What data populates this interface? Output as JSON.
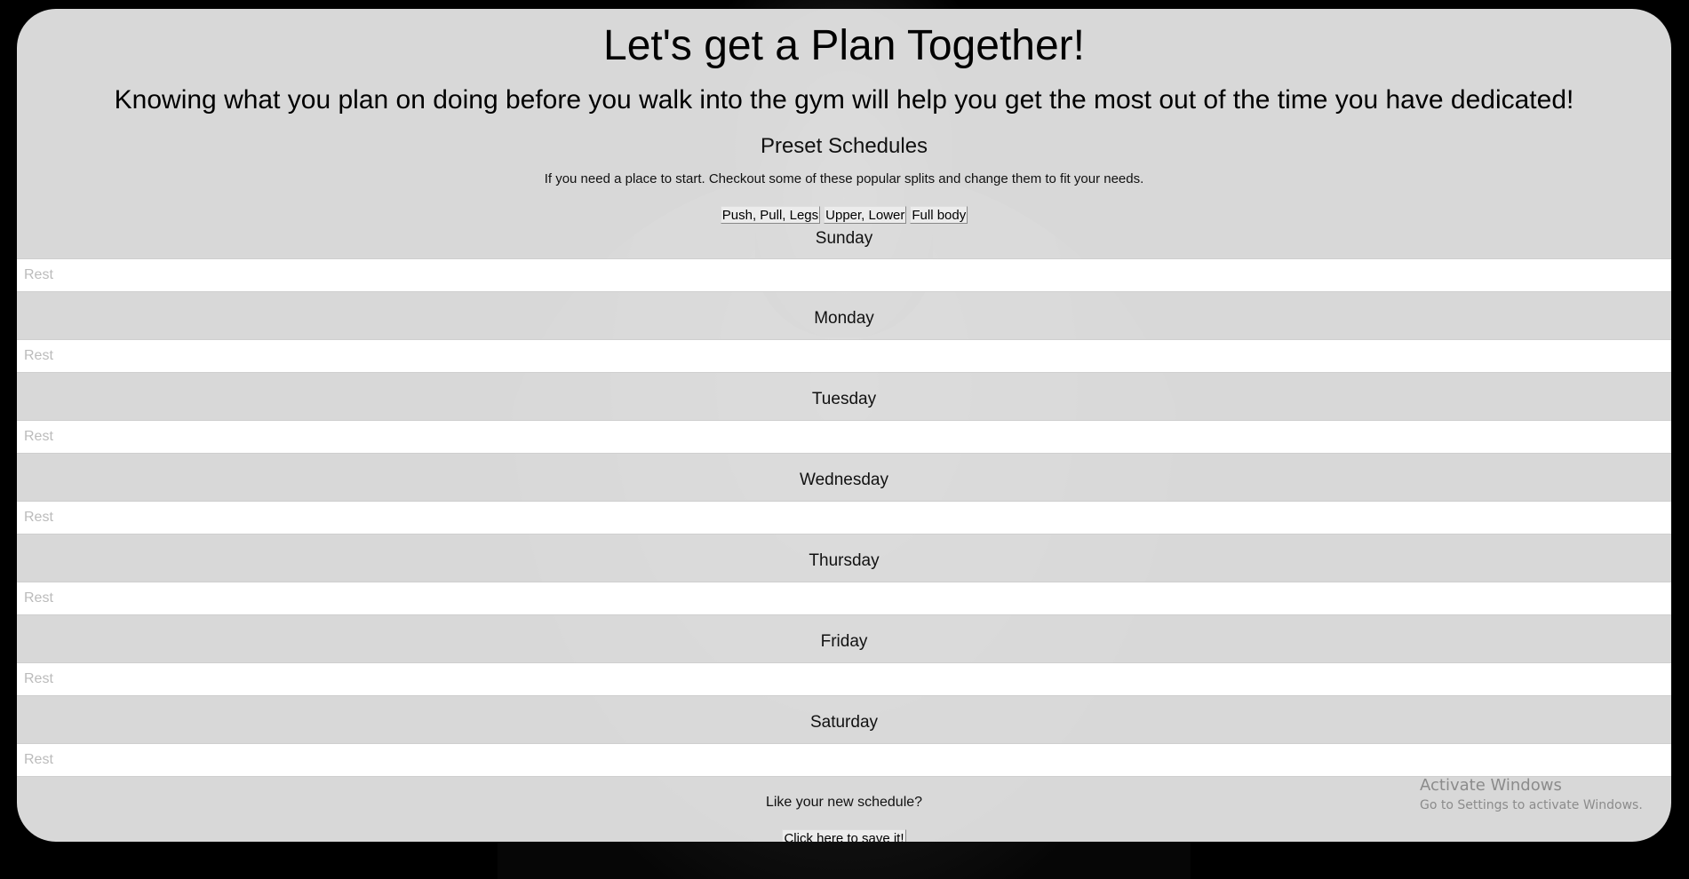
{
  "header": {
    "title": "Let's get a Plan Together!",
    "subtitle": "Knowing what you plan on doing before you walk into the gym will help you get the most out of the time you have dedicated!"
  },
  "presets": {
    "heading": "Preset Schedules",
    "description": "If you need a place to start. Checkout some of these popular splits and change them to fit your needs.",
    "buttons": [
      "Push, Pull, Legs",
      "Upper, Lower",
      "Full body"
    ]
  },
  "days": [
    {
      "label": "Sunday",
      "placeholder": "Rest",
      "value": ""
    },
    {
      "label": "Monday",
      "placeholder": "Rest",
      "value": ""
    },
    {
      "label": "Tuesday",
      "placeholder": "Rest",
      "value": ""
    },
    {
      "label": "Wednesday",
      "placeholder": "Rest",
      "value": ""
    },
    {
      "label": "Thursday",
      "placeholder": "Rest",
      "value": ""
    },
    {
      "label": "Friday",
      "placeholder": "Rest",
      "value": ""
    },
    {
      "label": "Saturday",
      "placeholder": "Rest",
      "value": ""
    }
  ],
  "footer": {
    "prompt": "Like your new schedule?",
    "save_label": "Click here to save it!"
  },
  "watermark": {
    "title": "Activate Windows",
    "subtitle": "Go to Settings to activate Windows."
  }
}
